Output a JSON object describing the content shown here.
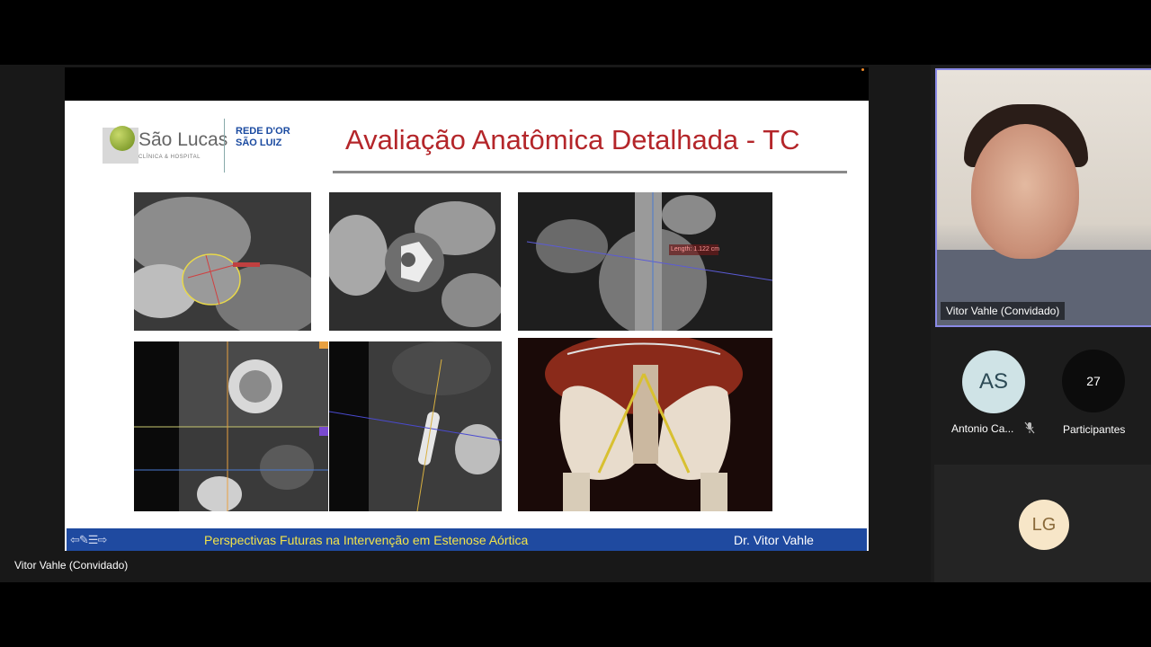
{
  "slide": {
    "title": "Avaliação Anatômica Detalhada - TC",
    "logo_name": "São Lucas",
    "logo_sub": "CLÍNICA & HOSPITAL",
    "logo_rede_line1": "REDE D'OR",
    "logo_rede_line2": "SÃO LUIZ",
    "measure_label": "Length: 1.122 cm",
    "footer_nav": "⇦✎☰⇨",
    "footer_title": "Perspectivas Futuras na Intervenção em Estenose Aórtica",
    "footer_author": "Dr. Vitor Vahle"
  },
  "presenter": {
    "caption": "Vitor Vahle (Convidado)"
  },
  "video_tile": {
    "name": "Vitor Vahle (Convidado)"
  },
  "participants": [
    {
      "initials": "AS",
      "label": "Antonio Ca...",
      "color": "#cfe3e6",
      "text_color": "#2c4a55",
      "muted": true
    },
    {
      "initials": "27",
      "label": "Participantes",
      "color": "#0c0c0c",
      "text_color": "#ffffff",
      "muted": false
    },
    {
      "initials": "LG",
      "label": "",
      "color": "#f7e6c8",
      "text_color": "#8a6a3a",
      "muted": false
    }
  ],
  "colors": {
    "title_red": "#b4262a",
    "footer_blue": "#1f4aa0",
    "footer_yellow": "#f2e34a",
    "tile_border": "#8a8ae6"
  },
  "icons": [
    "microphone-off-icon",
    "prev-arrow-icon",
    "pen-icon",
    "menu-icon",
    "next-arrow-icon"
  ]
}
